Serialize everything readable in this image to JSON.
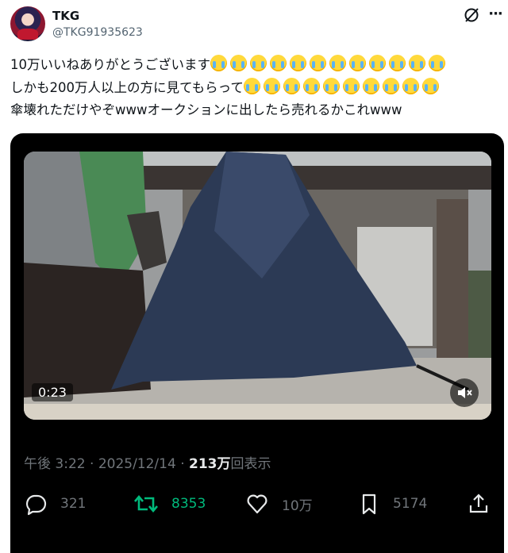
{
  "author": {
    "display_name": "TKG",
    "handle": "@TKG91935623"
  },
  "tweet": {
    "line1": "10万いいねありがとうございます",
    "line1_emoji_count": 12,
    "line2": "しかも200万人以上の方に見てもらって",
    "line2_emoji_count": 10,
    "line3": "傘壊れただけやぞwwwオークションに出したら売れるかこれwww",
    "emoji_name": "loudly-crying-face"
  },
  "video": {
    "duration": "0:23"
  },
  "meta": {
    "time": "午後 3:22",
    "separator": "·",
    "date": "2025/12/14",
    "views_count": "213万",
    "views_label": "回表示"
  },
  "actions": {
    "replies": "321",
    "retweets": "8353",
    "likes": "10万",
    "bookmarks": "5174"
  },
  "colors": {
    "retweet_green": "#00ba7c",
    "muted_gray": "#71767b",
    "card_background": "#000000"
  }
}
